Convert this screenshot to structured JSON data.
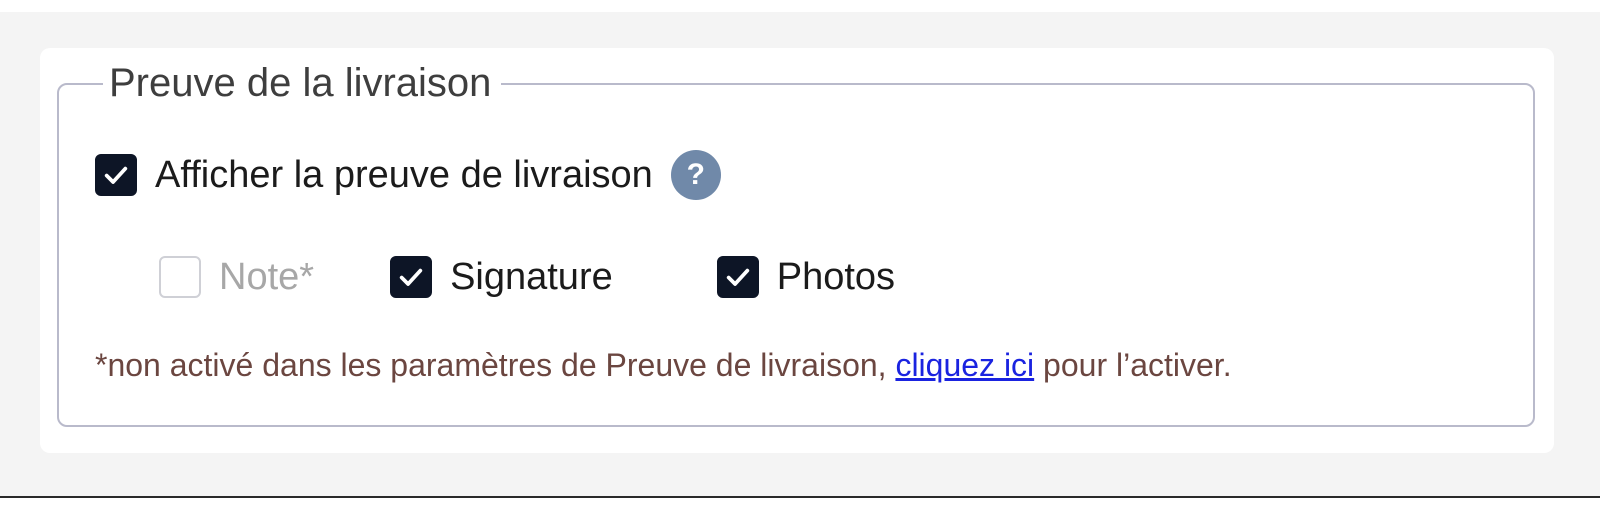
{
  "section": {
    "title": "Preuve de la livraison"
  },
  "show_proof": {
    "label": "Afficher la preuve de livraison",
    "checked": true,
    "help_icon_glyph": "?"
  },
  "options": {
    "note": {
      "label": "Note*",
      "checked": false,
      "disabled": true
    },
    "signature": {
      "label": "Signature",
      "checked": true
    },
    "photos": {
      "label": "Photos",
      "checked": true
    }
  },
  "footnote": {
    "prefix": "*non activé dans les paramètres de Preuve de livraison, ",
    "link_text": "cliquez ici",
    "suffix": " pour l’activer."
  },
  "colors": {
    "checkbox_checked": "#0d1526",
    "help_icon": "#7089a9",
    "footnote_text": "#6b4640",
    "link": "#1a23e0"
  }
}
